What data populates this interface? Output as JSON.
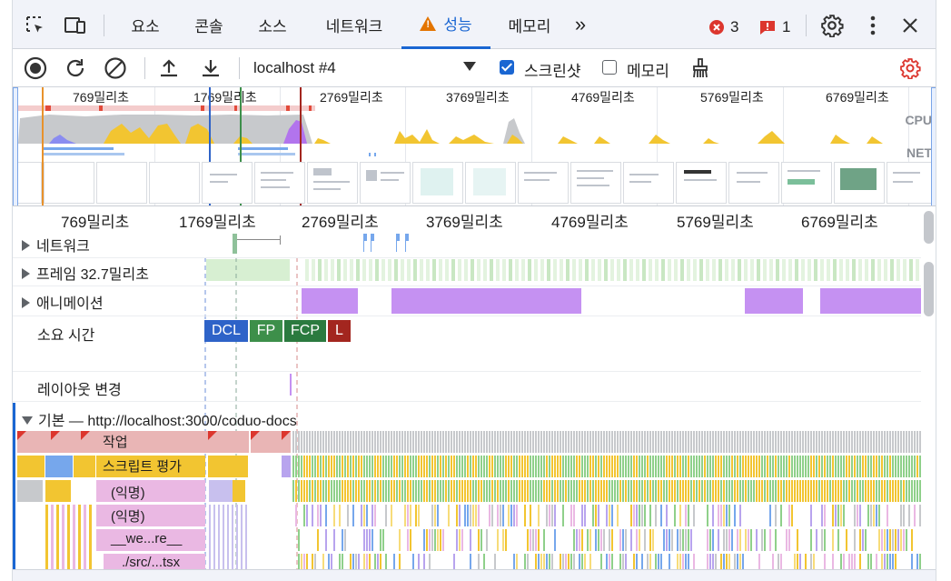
{
  "tabbar": {
    "tabs": [
      {
        "label": "요소"
      },
      {
        "label": "콘솔"
      },
      {
        "label": "소스"
      },
      {
        "label": "네트워크"
      },
      {
        "label": "성능"
      },
      {
        "label": "메모리"
      }
    ],
    "more_label": "»",
    "error_count": "3",
    "issue_count": "1"
  },
  "toolbar": {
    "target": "localhost #4",
    "screenshots_label": "스크린샷",
    "screenshots_checked": true,
    "memory_label": "메모리",
    "memory_checked": false
  },
  "overview": {
    "ticks": [
      "769밀리초",
      "1769밀리초",
      "2769밀리초",
      "3769밀리초",
      "4769밀리초",
      "5769밀리초",
      "6769밀리초"
    ],
    "cpu_label": "CPU",
    "net_label": "NET"
  },
  "timeline": {
    "ticks": [
      "769밀리초",
      "1769밀리초",
      "2769밀리초",
      "3769밀리초",
      "4769밀리초",
      "5769밀리초",
      "6769밀리초"
    ],
    "tracks": {
      "network": "네트워크",
      "frames": "프레임",
      "frames_time": "32.7밀리초",
      "animations": "애니메이션",
      "timings": "소요 시간",
      "layout_shifts": "레이아웃 변경",
      "main": "기본 — http://localhost:3000/coduo-docs"
    },
    "markers": [
      "DCL",
      "FP",
      "FCP",
      "L"
    ],
    "flame": {
      "task": "작업",
      "evaluate_script": "스크립트 평가",
      "anon1": "(익명)",
      "anon2": "(익명)",
      "webpack": "__we...re__",
      "src": "./src/...tsx"
    }
  },
  "colors": {
    "accent": "#1a66d2",
    "cpu_yellow": "#f2c531",
    "cpu_purple": "#b274ed",
    "animation": "#c591f2",
    "dcl": "#2e63c8",
    "fp": "#3d8f4a",
    "fcp": "#2b7a3f",
    "lcp": "#a3261f"
  }
}
